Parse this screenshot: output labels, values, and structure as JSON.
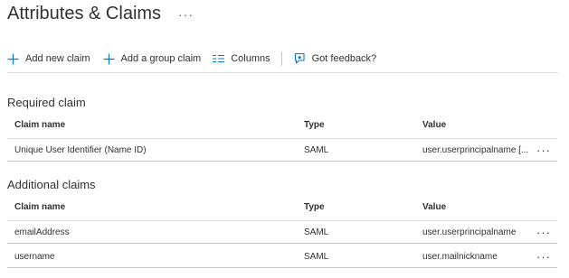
{
  "page": {
    "title": "Attributes & Claims",
    "more": "···"
  },
  "toolbar": {
    "add_new_claim": "Add new claim",
    "add_group_claim": "Add a group claim",
    "columns": "Columns",
    "feedback": "Got feedback?"
  },
  "required": {
    "title": "Required claim",
    "headers": {
      "name": "Claim name",
      "type": "Type",
      "value": "Value"
    },
    "rows": [
      {
        "name": "Unique User Identifier (Name ID)",
        "type": "SAML",
        "value": "user.userprincipalname [...",
        "more": "···"
      }
    ]
  },
  "additional": {
    "title": "Additional claims",
    "headers": {
      "name": "Claim name",
      "type": "Type",
      "value": "Value"
    },
    "rows": [
      {
        "name": "emailAddress",
        "type": "SAML",
        "value": "user.userprincipalname",
        "more": "···"
      },
      {
        "name": "username",
        "type": "SAML",
        "value": "user.mailnickname",
        "more": "···"
      }
    ]
  },
  "colors": {
    "accent": "#0078d4",
    "text": "#323130",
    "divider": "#e1dfdd"
  }
}
